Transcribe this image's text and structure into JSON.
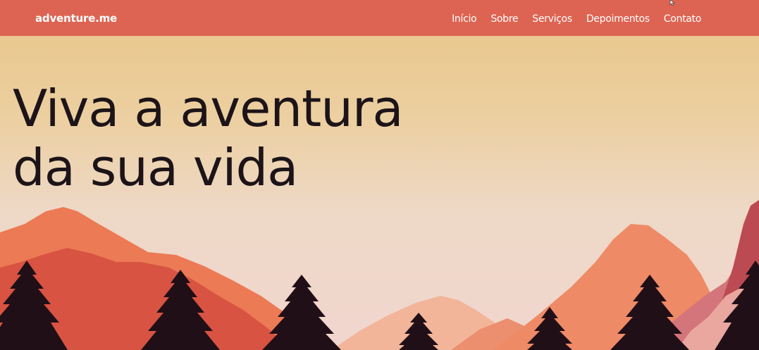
{
  "navbar": {
    "logo": "adventure.me",
    "links": [
      {
        "label": "Início"
      },
      {
        "label": "Sobre"
      },
      {
        "label": "Serviços"
      },
      {
        "label": "Depoimentos"
      },
      {
        "label": "Contato"
      }
    ]
  },
  "hero": {
    "title_line1": "Viva a aventura",
    "title_line2": "da sua vida"
  },
  "colors": {
    "navbar_bg": "#dd6452",
    "sky_top": "#e9c587",
    "sky_bottom": "#f1d6cf",
    "title_text": "#1c1418",
    "tree_color": "#200f17"
  },
  "icons": {
    "cursor": "mouse-pointer-icon"
  }
}
